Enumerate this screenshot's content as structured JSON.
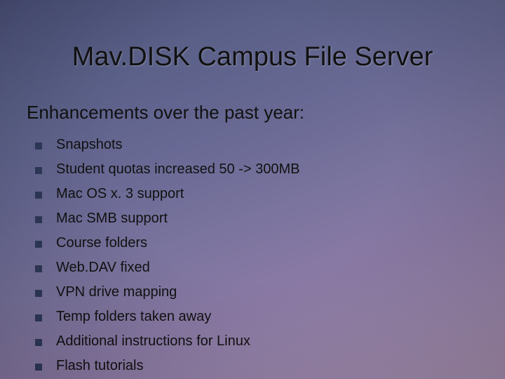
{
  "title": "Mav.DISK Campus File Server",
  "subtitle": "Enhancements over the past year:",
  "bullets": [
    "Snapshots",
    "Student quotas increased 50 -> 300MB",
    "Mac OS x. 3 support",
    "Mac SMB support",
    "Course folders",
    "Web.DAV fixed",
    "VPN drive mapping",
    "Temp folders taken away",
    "Additional instructions for Linux",
    "Flash tutorials"
  ]
}
